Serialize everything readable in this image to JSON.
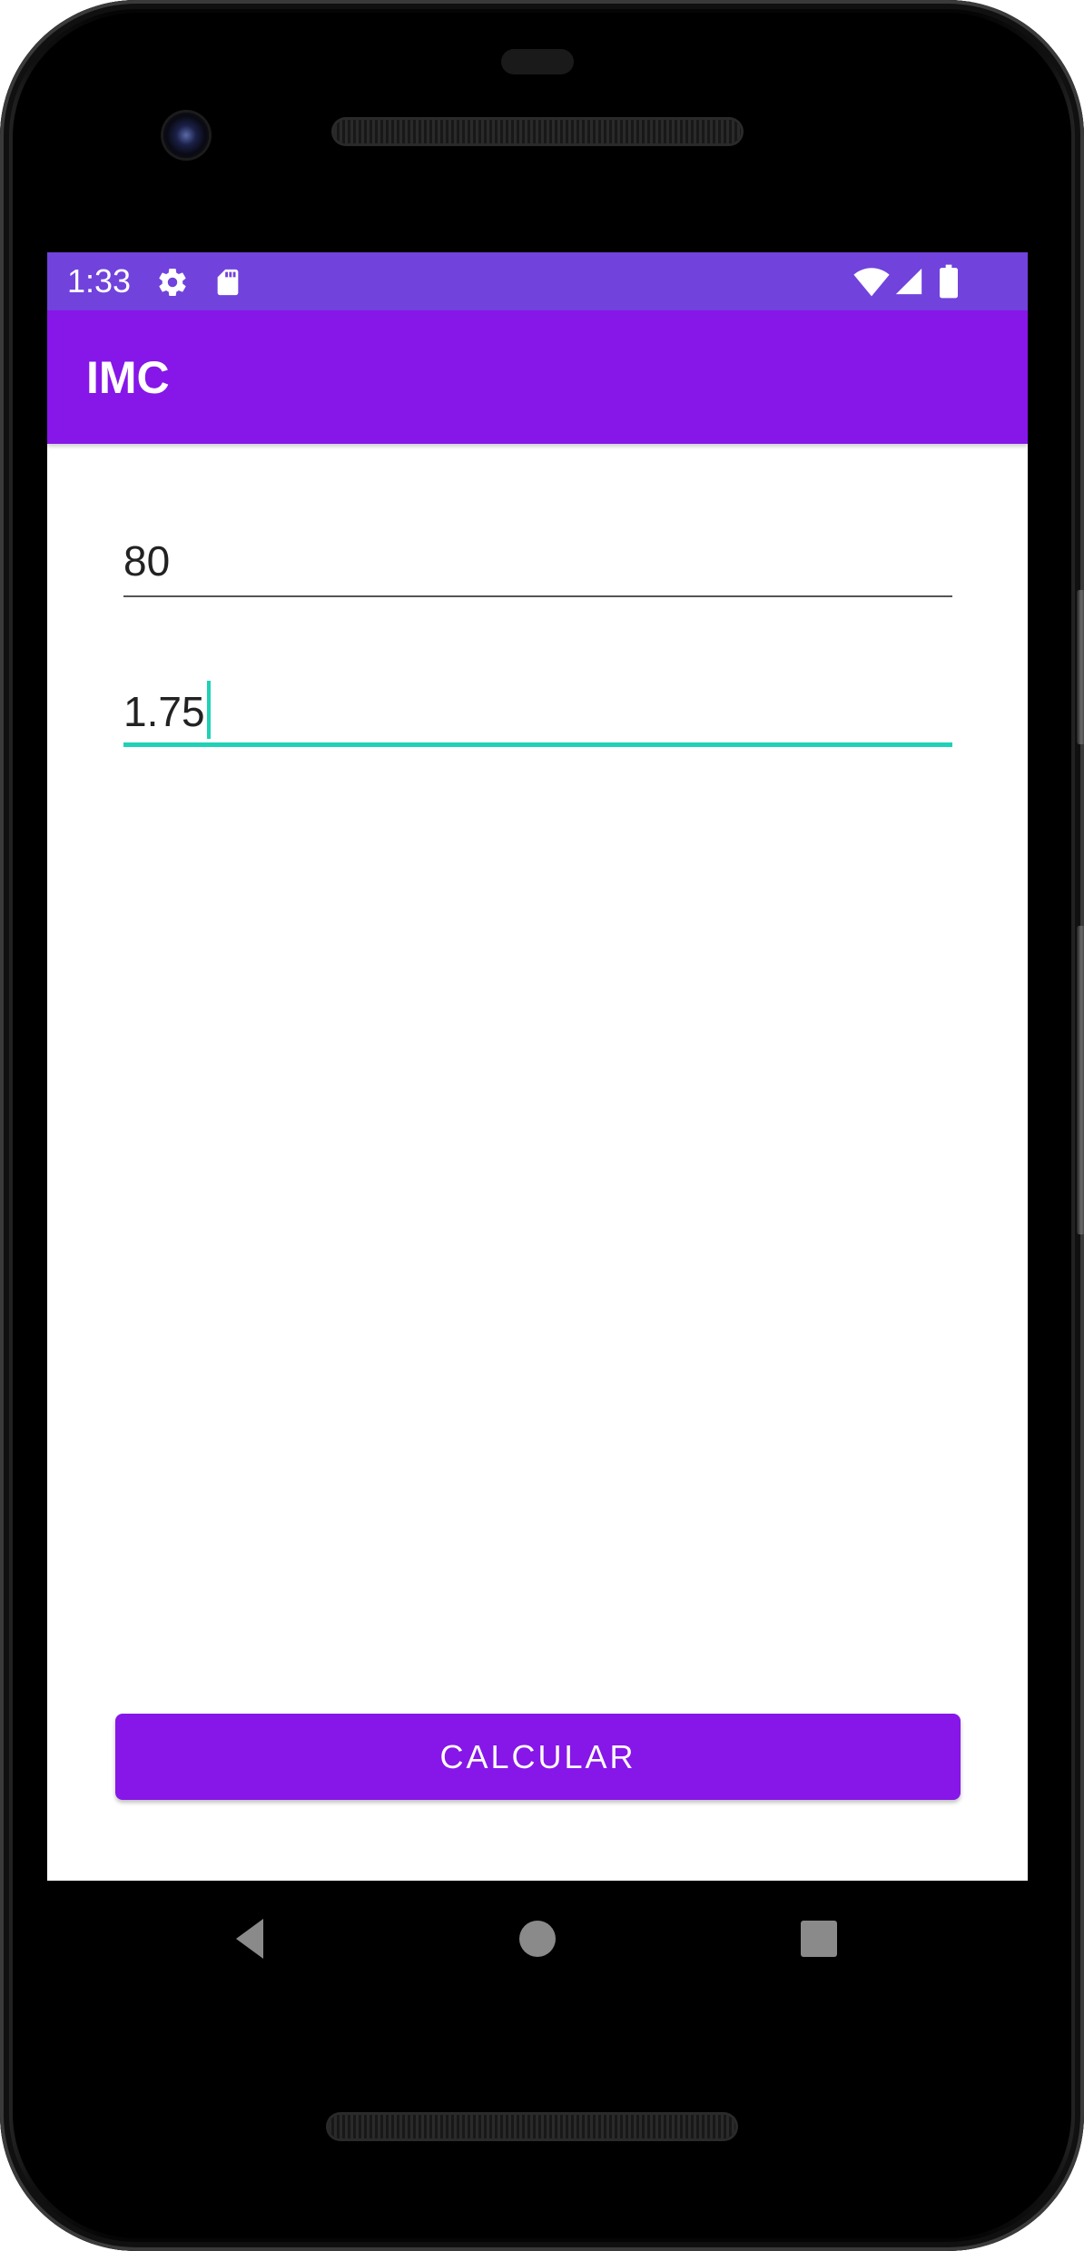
{
  "status_bar": {
    "time": "1:33",
    "icons_left": [
      "gear-icon",
      "sd-card-icon"
    ],
    "icons_right": [
      "wifi-icon",
      "cell-signal-icon",
      "battery-icon"
    ],
    "color": "#7142dc"
  },
  "app_bar": {
    "title": "IMC",
    "color": "#8716e8"
  },
  "form": {
    "weight_value": "80",
    "height_value": "1.75"
  },
  "actions": {
    "calculate_label": "CALCULAR"
  },
  "navigation": {
    "buttons": [
      "back-icon",
      "home-icon",
      "recents-icon"
    ]
  },
  "colors": {
    "accent": "#1fd1b6",
    "primary": "#8716e8",
    "primary_dark": "#7142dc"
  }
}
